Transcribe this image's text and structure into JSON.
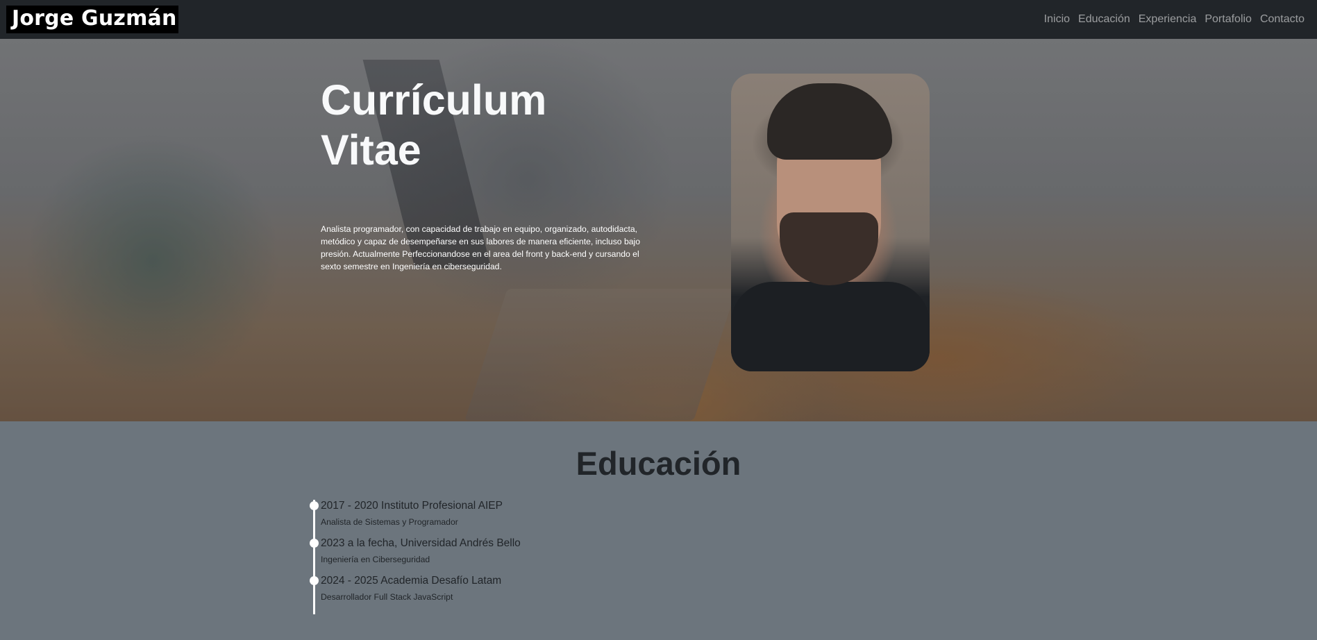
{
  "navbar": {
    "brand": "Jorge Guzmán",
    "links": [
      "Inicio",
      "Educación",
      "Experiencia",
      "Portafolio",
      "Contacto"
    ]
  },
  "hero": {
    "title_line1": "Currículum",
    "title_line2": "Vitae",
    "description": "Analista programador, con capacidad de trabajo en equipo, organizado, autodidacta, metódico y capaz de desempeñarse en sus labores de manera eficiente, incluso bajo presión. Actualmente Perfeccionandose en el area del front y back-end y cursando el sexto semestre en Ingeniería en ciberseguridad."
  },
  "education": {
    "title": "Educación",
    "items": [
      {
        "heading": "2017 - 2020 Instituto Profesional AIEP",
        "detail": "Analista de Sistemas y Programador"
      },
      {
        "heading": "2023 a la fecha, Universidad Andrés Bello",
        "detail": "Ingeniería en Ciberseguridad"
      },
      {
        "heading": "2024 - 2025 Academia Desafío Latam",
        "detail": "Desarrollador Full Stack JavaScript"
      }
    ]
  }
}
